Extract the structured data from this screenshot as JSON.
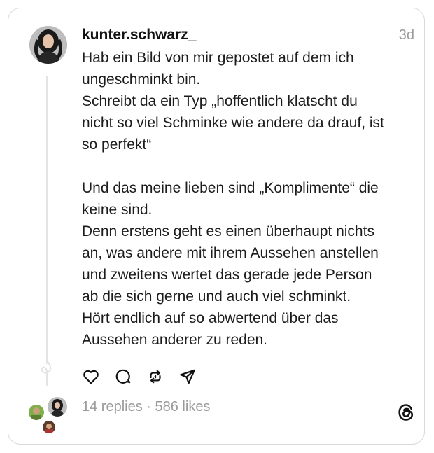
{
  "post": {
    "username": "kunter.schwarz_",
    "time": "3d",
    "paragraphs": [
      [
        "Hab ein Bild von mir gepostet auf dem ich",
        "ungeschminkt bin.",
        "Schreibt da ein Typ „hoffentlich klatscht du",
        "nicht so viel Schminke wie andere da drauf, ist",
        "so perfekt“"
      ],
      [
        "Und das meine lieben sind „Komplimente“ die",
        "keine sind.",
        "Denn erstens geht es einen überhaupt nichts",
        "an, was andere mit ihrem Aussehen anstellen",
        "und zweitens wertet das gerade jede Person",
        "ab die sich gerne und auch viel schminkt.",
        "Hört endlich auf so abwertend über das",
        "Aussehen anderer zu reden."
      ]
    ]
  },
  "actions": [
    {
      "name": "like-icon"
    },
    {
      "name": "reply-icon"
    },
    {
      "name": "repost-icon"
    },
    {
      "name": "share-icon"
    }
  ],
  "stats": {
    "replies": "14 replies",
    "separator": " · ",
    "likes": "586 likes"
  },
  "colors": {
    "text": "#1c1c1c",
    "muted": "#9a9a9a",
    "border": "#d9d9d9"
  }
}
